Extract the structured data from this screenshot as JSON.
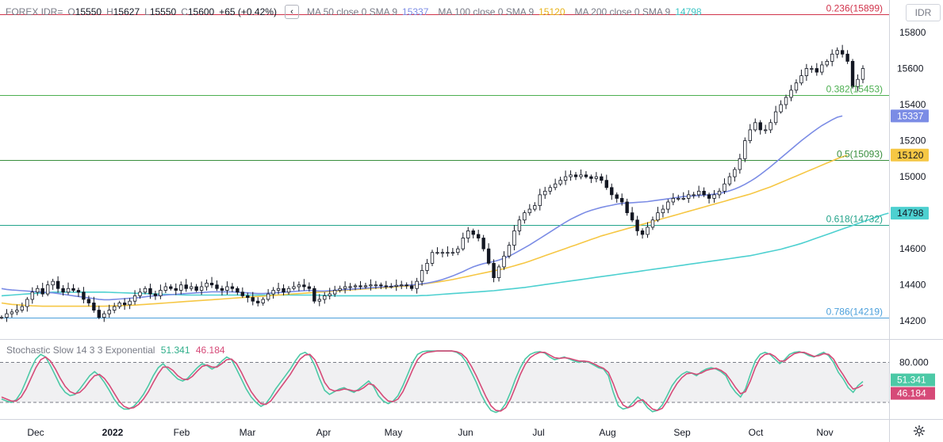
{
  "header": {
    "symbol": "FOREX IDR=",
    "open_label": "O",
    "open": "15550",
    "high_label": "H",
    "high": "15627",
    "low_label": "L",
    "low": "15550",
    "close_label": "C",
    "close": "15600",
    "change": "+65 (+0.42%)",
    "ma50_label": "MA 50 close 0 SMA 9",
    "ma50_value": "15337",
    "ma100_label": "MA 100 close 0 SMA 9",
    "ma100_value": "15120",
    "ma200_label": "MA 200 close 0 SMA 9",
    "ma200_value": "14798"
  },
  "currency_button": "IDR",
  "collapse_icon": "chevron-left-icon",
  "settings_icon": "gear-icon",
  "stochastic": {
    "label": "Stochastic Slow 14 3 3 Exponential",
    "k_value": "51.341",
    "d_value": "46.184",
    "upper_band_label": "80.000",
    "upper_band": 80,
    "lower_band": 20
  },
  "colors": {
    "ma50": "#7b8ce5",
    "ma100": "#f6c744",
    "ma200": "#4dd0d0",
    "fib_0236": "#d1334b",
    "fib_0382": "#4caf50",
    "fib_05": "#388e3c",
    "fib_0618": "#22a38a",
    "fib_0786": "#4a9fdb",
    "stoch_k": "#4cc9a6",
    "stoch_d": "#d64a78",
    "last_price": "#131722"
  },
  "chart_data": {
    "type": "candlestick",
    "price_axis_ticks": [
      "15800",
      "15600",
      "15400",
      "15200",
      "15000",
      "14600",
      "14400",
      "14200"
    ],
    "price_range": [
      14100,
      15980
    ],
    "time_axis_labels": [
      "Dec",
      "2022",
      "Feb",
      "Mar",
      "Apr",
      "May",
      "Jun",
      "Jul",
      "Aug",
      "Sep",
      "Oct",
      "Nov"
    ],
    "last_price_label": "15600",
    "fibonacci_levels": [
      {
        "label": "0.236(15899)",
        "value": 15899
      },
      {
        "label": "0.382(15453)",
        "value": 15453
      },
      {
        "label": "0.5(15093)",
        "value": 15093
      },
      {
        "label": "0.618(14732)",
        "value": 14732
      },
      {
        "label": "0.786(14219)",
        "value": 14219
      }
    ],
    "ma_badges": [
      {
        "name": "MA 50",
        "value": "15337"
      },
      {
        "name": "MA 100",
        "value": "15120"
      },
      {
        "name": "MA 200",
        "value": "14798"
      }
    ],
    "closes": [
      14220,
      14240,
      14250,
      14260,
      14280,
      14320,
      14360,
      14380,
      14350,
      14400,
      14420,
      14380,
      14360,
      14380,
      14370,
      14360,
      14320,
      14300,
      14260,
      14220,
      14240,
      14260,
      14280,
      14300,
      14290,
      14310,
      14340,
      14360,
      14380,
      14350,
      14340,
      14370,
      14390,
      14380,
      14370,
      14400,
      14380,
      14390,
      14370,
      14390,
      14410,
      14400,
      14380,
      14370,
      14390,
      14380,
      14360,
      14340,
      14330,
      14310,
      14300,
      14320,
      14350,
      14370,
      14380,
      14360,
      14380,
      14390,
      14400,
      14390,
      14380,
      14310,
      14320,
      14340,
      14350,
      14370,
      14380,
      14390,
      14390,
      14395,
      14390,
      14395,
      14400,
      14400,
      14395,
      14390,
      14392,
      14398,
      14400,
      14395,
      14380,
      14420,
      14480,
      14520,
      14580,
      14580,
      14580,
      14580,
      14580,
      14600,
      14660,
      14700,
      14680,
      14660,
      14600,
      14520,
      14440,
      14500,
      14560,
      14620,
      14700,
      14760,
      14800,
      14820,
      14840,
      14900,
      14920,
      14940,
      14960,
      14980,
      15000,
      15010,
      15000,
      15010,
      15000,
      14990,
      15000,
      14980,
      14940,
      14900,
      14880,
      14860,
      14800,
      14760,
      14700,
      14680,
      14720,
      14760,
      14800,
      14820,
      14860,
      14880,
      14880,
      14880,
      14900,
      14900,
      14920,
      14900,
      14880,
      14900,
      14920,
      14960,
      15000,
      15040,
      15100,
      15200,
      15260,
      15300,
      15260,
      15260,
      15300,
      15360,
      15400,
      15440,
      15480,
      15520,
      15560,
      15600,
      15600,
      15580,
      15620,
      15640,
      15680,
      15700,
      15680,
      15640,
      15500,
      15540,
      15600
    ],
    "ma50": [
      14380,
      14375,
      14372,
      14370,
      14368,
      14366,
      14364,
      14362,
      14360,
      14358,
      14356,
      14352,
      14348,
      14344,
      14340,
      14336,
      14332,
      14328,
      14324,
      14320,
      14318,
      14318,
      14320,
      14322,
      14324,
      14326,
      14328,
      14330,
      14334,
      14338,
      14340,
      14342,
      14344,
      14346,
      14348,
      14350,
      14352,
      14354,
      14356,
      14358,
      14360,
      14362,
      14362,
      14362,
      14362,
      14362,
      14360,
      14358,
      14356,
      14354,
      14352,
      14352,
      14354,
      14356,
      14358,
      14360,
      14362,
      14364,
      14366,
      14368,
      14370,
      14368,
      14366,
      14366,
      14368,
      14370,
      14372,
      14374,
      14376,
      14378,
      14380,
      14382,
      14384,
      14386,
      14388,
      14390,
      14392,
      14394,
      14396,
      14398,
      14400,
      14402,
      14406,
      14410,
      14416,
      14422,
      14430,
      14440,
      14450,
      14462,
      14474,
      14488,
      14500,
      14510,
      14518,
      14524,
      14530,
      14538,
      14548,
      14560,
      14574,
      14590,
      14606,
      14622,
      14640,
      14658,
      14676,
      14694,
      14712,
      14730,
      14748,
      14764,
      14778,
      14792,
      14804,
      14814,
      14822,
      14830,
      14836,
      14842,
      14848,
      14852,
      14854,
      14856,
      14858,
      14860,
      14862,
      14866,
      14870,
      14874,
      14878,
      14882,
      14886,
      14890,
      14892,
      14894,
      14896,
      14898,
      14900,
      14904,
      14908,
      14914,
      14922,
      14932,
      14944,
      14958,
      14974,
      14992,
      15012,
      15034,
      15056,
      15080,
      15104,
      15128,
      15152,
      15176,
      15200,
      15222,
      15244,
      15264,
      15284,
      15300,
      15316,
      15330,
      15337
    ],
    "ma100": [
      14300,
      14296,
      14292,
      14290,
      14288,
      14286,
      14284,
      14283,
      14282,
      14282,
      14282,
      14282,
      14282,
      14282,
      14282,
      14282,
      14282,
      14282,
      14282,
      14282,
      14282,
      14283,
      14284,
      14285,
      14286,
      14287,
      14288,
      14290,
      14292,
      14294,
      14296,
      14298,
      14300,
      14302,
      14304,
      14306,
      14308,
      14310,
      14312,
      14314,
      14316,
      14318,
      14320,
      14322,
      14324,
      14326,
      14328,
      14330,
      14332,
      14334,
      14336,
      14338,
      14340,
      14342,
      14344,
      14346,
      14348,
      14350,
      14352,
      14354,
      14356,
      14358,
      14360,
      14362,
      14364,
      14366,
      14368,
      14370,
      14372,
      14374,
      14376,
      14378,
      14380,
      14382,
      14384,
      14386,
      14388,
      14390,
      14392,
      14394,
      14396,
      14400,
      14404,
      14408,
      14412,
      14416,
      14420,
      14425,
      14430,
      14436,
      14442,
      14448,
      14454,
      14460,
      14466,
      14472,
      14478,
      14484,
      14490,
      14498,
      14506,
      14514,
      14522,
      14532,
      14542,
      14552,
      14562,
      14572,
      14582,
      14592,
      14602,
      14612,
      14622,
      14632,
      14642,
      14652,
      14662,
      14672,
      14680,
      14688,
      14696,
      14704,
      14712,
      14720,
      14728,
      14736,
      14744,
      14752,
      14760,
      14768,
      14776,
      14784,
      14792,
      14800,
      14808,
      14816,
      14824,
      14832,
      14840,
      14848,
      14856,
      14864,
      14872,
      14880,
      14888,
      14896,
      14904,
      14914,
      14924,
      14934,
      14944,
      14956,
      14968,
      14980,
      14992,
      15004,
      15016,
      15028,
      15040,
      15052,
      15064,
      15076,
      15088,
      15100,
      15110,
      15120
    ],
    "ma200": [
      14340,
      14342,
      14344,
      14346,
      14348,
      14350,
      14352,
      14354,
      14356,
      14358,
      14360,
      14360,
      14360,
      14360,
      14360,
      14360,
      14360,
      14360,
      14360,
      14360,
      14360,
      14359,
      14358,
      14357,
      14356,
      14355,
      14354,
      14353,
      14352,
      14351,
      14350,
      14349,
      14348,
      14347,
      14346,
      14345,
      14344,
      14344,
      14344,
      14344,
      14344,
      14344,
      14344,
      14344,
      14344,
      14344,
      14344,
      14344,
      14344,
      14344,
      14344,
      14344,
      14344,
      14344,
      14344,
      14344,
      14344,
      14344,
      14344,
      14344,
      14344,
      14344,
      14343,
      14342,
      14341,
      14340,
      14340,
      14340,
      14340,
      14340,
      14340,
      14340,
      14340,
      14340,
      14340,
      14340,
      14340,
      14340,
      14340,
      14340,
      14340,
      14340,
      14341,
      14342,
      14344,
      14346,
      14348,
      14350,
      14352,
      14354,
      14356,
      14358,
      14360,
      14362,
      14364,
      14366,
      14368,
      14371,
      14374,
      14377,
      14380,
      14383,
      14386,
      14390,
      14394,
      14398,
      14402,
      14406,
      14410,
      14414,
      14418,
      14422,
      14426,
      14430,
      14434,
      14438,
      14442,
      14446,
      14450,
      14454,
      14458,
      14462,
      14466,
      14470,
      14474,
      14478,
      14482,
      14486,
      14490,
      14494,
      14498,
      14502,
      14506,
      14510,
      14514,
      14518,
      14522,
      14526,
      14530,
      14534,
      14538,
      14542,
      14546,
      14550,
      14554,
      14558,
      14562,
      14568,
      14574,
      14580,
      14586,
      14592,
      14598,
      14606,
      14614,
      14622,
      14630,
      14640,
      14650,
      14660,
      14670,
      14680,
      14690,
      14700,
      14710,
      14720,
      14730,
      14740,
      14750,
      14760,
      14770,
      14780,
      14790,
      14798
    ],
    "stoch_k": [
      25,
      22,
      20,
      24,
      35,
      52,
      70,
      85,
      92,
      88,
      75,
      60,
      45,
      35,
      30,
      32,
      40,
      50,
      60,
      66,
      60,
      50,
      38,
      25,
      15,
      10,
      10,
      14,
      22,
      32,
      45,
      60,
      72,
      78,
      70,
      62,
      55,
      52,
      56,
      64,
      72,
      78,
      75,
      70,
      74,
      82,
      88,
      84,
      70,
      55,
      40,
      28,
      20,
      14,
      18,
      28,
      40,
      50,
      60,
      70,
      82,
      92,
      95,
      90,
      75,
      55,
      38,
      32,
      36,
      40,
      42,
      38,
      35,
      40,
      46,
      52,
      44,
      30,
      22,
      18,
      22,
      30,
      45,
      62,
      80,
      92,
      96,
      97,
      97,
      97,
      97,
      97,
      97,
      95,
      90,
      80,
      65,
      50,
      32,
      18,
      8,
      5,
      8,
      18,
      35,
      55,
      72,
      85,
      92,
      95,
      96,
      94,
      88,
      84,
      86,
      88,
      85,
      82,
      80,
      82,
      80,
      76,
      72,
      70,
      60,
      35,
      15,
      10,
      12,
      20,
      28,
      22,
      12,
      6,
      8,
      16,
      30,
      45,
      55,
      62,
      66,
      64,
      60,
      66,
      70,
      72,
      70,
      66,
      60,
      45,
      35,
      28,
      40,
      62,
      82,
      92,
      95,
      92,
      85,
      78,
      84,
      92,
      95,
      96,
      94,
      90,
      88,
      92,
      95,
      90,
      80,
      65,
      55,
      42,
      35,
      45,
      51.341
    ],
    "stoch_d": [
      28,
      25,
      22,
      22,
      28,
      40,
      56,
      72,
      84,
      88,
      82,
      70,
      56,
      44,
      36,
      33,
      35,
      42,
      52,
      60,
      62,
      56,
      46,
      34,
      22,
      14,
      11,
      12,
      17,
      25,
      36,
      50,
      63,
      73,
      73,
      68,
      60,
      55,
      54,
      59,
      67,
      74,
      76,
      73,
      73,
      78,
      84,
      85,
      78,
      65,
      50,
      36,
      26,
      18,
      17,
      22,
      32,
      42,
      52,
      62,
      74,
      85,
      91,
      92,
      84,
      68,
      50,
      40,
      37,
      38,
      40,
      39,
      37,
      38,
      42,
      48,
      46,
      38,
      29,
      22,
      21,
      25,
      36,
      52,
      69,
      84,
      92,
      95,
      96,
      97,
      97,
      97,
      97,
      96,
      93,
      86,
      74,
      60,
      44,
      28,
      15,
      8,
      7,
      12,
      25,
      43,
      62,
      77,
      87,
      92,
      95,
      95,
      91,
      87,
      86,
      87,
      86,
      84,
      82,
      82,
      81,
      78,
      74,
      71,
      65,
      48,
      28,
      16,
      12,
      15,
      22,
      24,
      17,
      10,
      8,
      11,
      22,
      36,
      48,
      57,
      63,
      64,
      62,
      64,
      68,
      70,
      71,
      68,
      63,
      53,
      42,
      33,
      36,
      52,
      72,
      86,
      92,
      93,
      89,
      82,
      82,
      88,
      93,
      95,
      95,
      92,
      89,
      90,
      93,
      92,
      85,
      72,
      61,
      49,
      40,
      42,
      46.184
    ]
  }
}
